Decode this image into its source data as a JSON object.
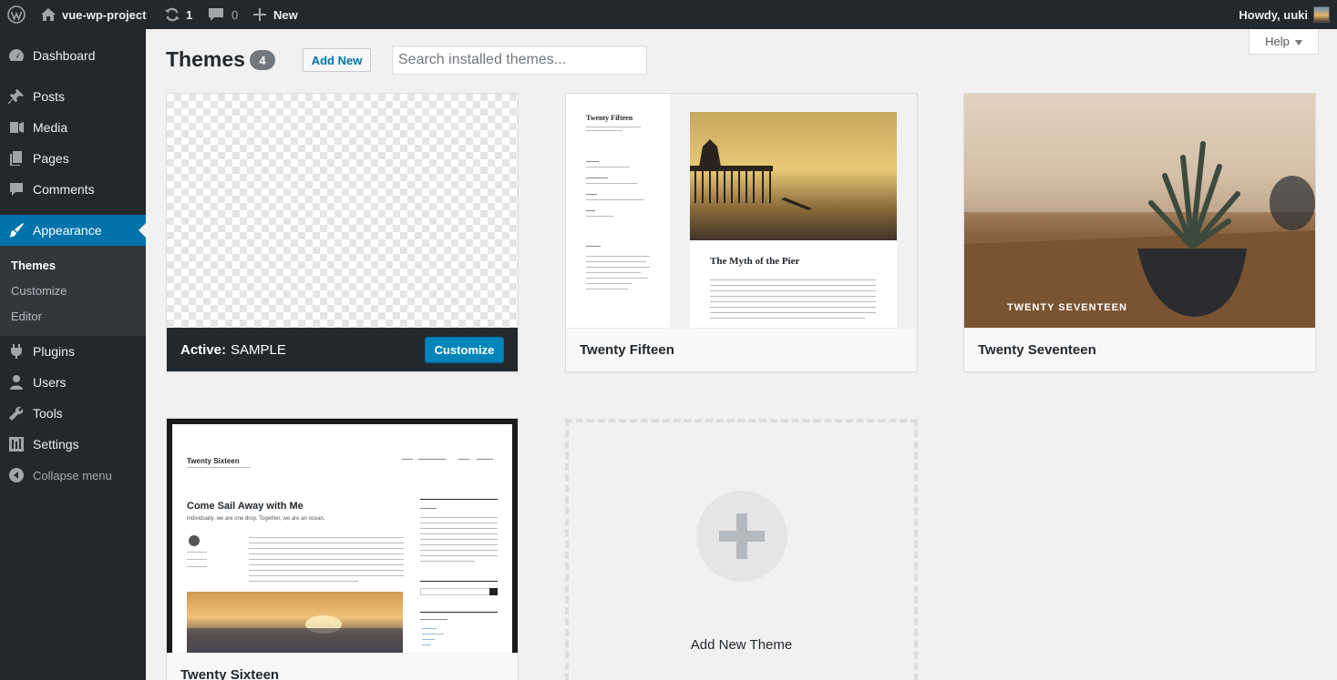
{
  "adminbar": {
    "site_name": "vue-wp-project",
    "updates_count": "1",
    "comments_count": "0",
    "new_label": "New",
    "howdy": "Howdy, uuki"
  },
  "sidebar": {
    "items": [
      {
        "label": "Dashboard",
        "icon": "dashboard-icon"
      },
      {
        "label": "Posts",
        "icon": "pushpin-icon"
      },
      {
        "label": "Media",
        "icon": "media-icon"
      },
      {
        "label": "Pages",
        "icon": "pages-icon"
      },
      {
        "label": "Comments",
        "icon": "comments-icon"
      },
      {
        "label": "Appearance",
        "icon": "paintbrush-icon"
      },
      {
        "label": "Plugins",
        "icon": "plugins-icon"
      },
      {
        "label": "Users",
        "icon": "users-icon"
      },
      {
        "label": "Tools",
        "icon": "wrench-icon"
      },
      {
        "label": "Settings",
        "icon": "settings-icon"
      }
    ],
    "submenu": [
      "Themes",
      "Customize",
      "Editor"
    ],
    "collapse": "Collapse menu"
  },
  "header": {
    "title": "Themes",
    "count": "4",
    "add_new": "Add New",
    "search_placeholder": "Search installed themes...",
    "help": "Help"
  },
  "themes": [
    {
      "name": "SAMPLE",
      "active_label": "Active:",
      "customize": "Customize"
    },
    {
      "name": "Twenty Fifteen",
      "shot_title": "Twenty Fifteen",
      "shot_post": "The Myth of the Pier"
    },
    {
      "name": "Twenty Seventeen",
      "shot_title": "TWENTY SEVENTEEN"
    },
    {
      "name": "Twenty Sixteen",
      "shot_title": "Twenty Sixteen",
      "shot_post": "Come Sail Away with Me",
      "shot_sub": "Individually, we are one drop. Together, we are an ocean."
    }
  ],
  "add_new_theme": "Add New Theme",
  "colors": {
    "accent": "#0073aa",
    "adminbar": "#23282d",
    "button": "#0085ba"
  }
}
